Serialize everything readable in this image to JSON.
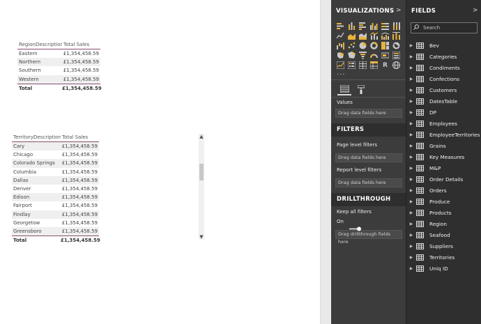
{
  "table_region": {
    "headers": [
      "RegionDescription",
      "Total Sales"
    ],
    "rows": [
      [
        "Eastern",
        "£1,354,458.59"
      ],
      [
        "Northern",
        "£1,354,458.59"
      ],
      [
        "Southern",
        "£1,354,458.59"
      ],
      [
        "Western",
        "£1,354,458.59"
      ]
    ],
    "total": [
      "Total",
      "£1,354,458.59"
    ]
  },
  "table_territory": {
    "headers": [
      "TerritoryDescription",
      "Total Sales"
    ],
    "rows": [
      [
        "Cary",
        "£1,354,458.59"
      ],
      [
        "Chicago",
        "£1,354,458.59"
      ],
      [
        "Colorado Springs",
        "£1,354,458.59"
      ],
      [
        "Columbia",
        "£1,354,458.59"
      ],
      [
        "Dallas",
        "£1,354,458.59"
      ],
      [
        "Denver",
        "£1,354,458.59"
      ],
      [
        "Edison",
        "£1,354,458.59"
      ],
      [
        "Fairport",
        "£1,354,458.59"
      ],
      [
        "Findlay",
        "£1,354,458.59"
      ],
      [
        "Georgetow",
        "£1,354,458.59"
      ],
      [
        "Greensboro",
        "£1,354,458.59"
      ]
    ],
    "total": [
      "Total",
      "£1,354,458.59"
    ]
  },
  "viz_pane": {
    "title": "VISUALIZATIONS",
    "chevron": ">",
    "more": "...",
    "values_label": "Values",
    "values_placeholder": "Drag data fields here",
    "filters_title": "FILTERS",
    "page_filters_label": "Page level filters",
    "page_filters_placeholder": "Drag data fields here",
    "report_filters_label": "Report level filters",
    "report_filters_placeholder": "Drag data fields here",
    "drillthrough_title": "DRILLTHROUGH",
    "keep_filters_label": "Keep all filters",
    "toggle_state": "On",
    "drillthrough_placeholder": "Drag drillthrough fields here",
    "r_icon": "R"
  },
  "fields_pane": {
    "title": "FIELDS",
    "chevron": ">",
    "search_placeholder": "Search",
    "items": [
      "Bev",
      "Categories",
      "Condiments",
      "Confections",
      "Customers",
      "DatesTable",
      "DP",
      "Employees",
      "EmployeeTerritories",
      "Grains",
      "Key Measures",
      "M&P",
      "Order Details",
      "Orders",
      "Produce",
      "Products",
      "Region",
      "Seafood",
      "Suppliers",
      "Territories",
      "Uniq ID"
    ]
  },
  "colors": {
    "accent_border": "#8b4d6e",
    "pane_bg": "#3c3c3c",
    "fields_bg": "#2f2f2f",
    "icon_yellow": "#e8b33a",
    "icon_grey": "#c9c9c9"
  }
}
